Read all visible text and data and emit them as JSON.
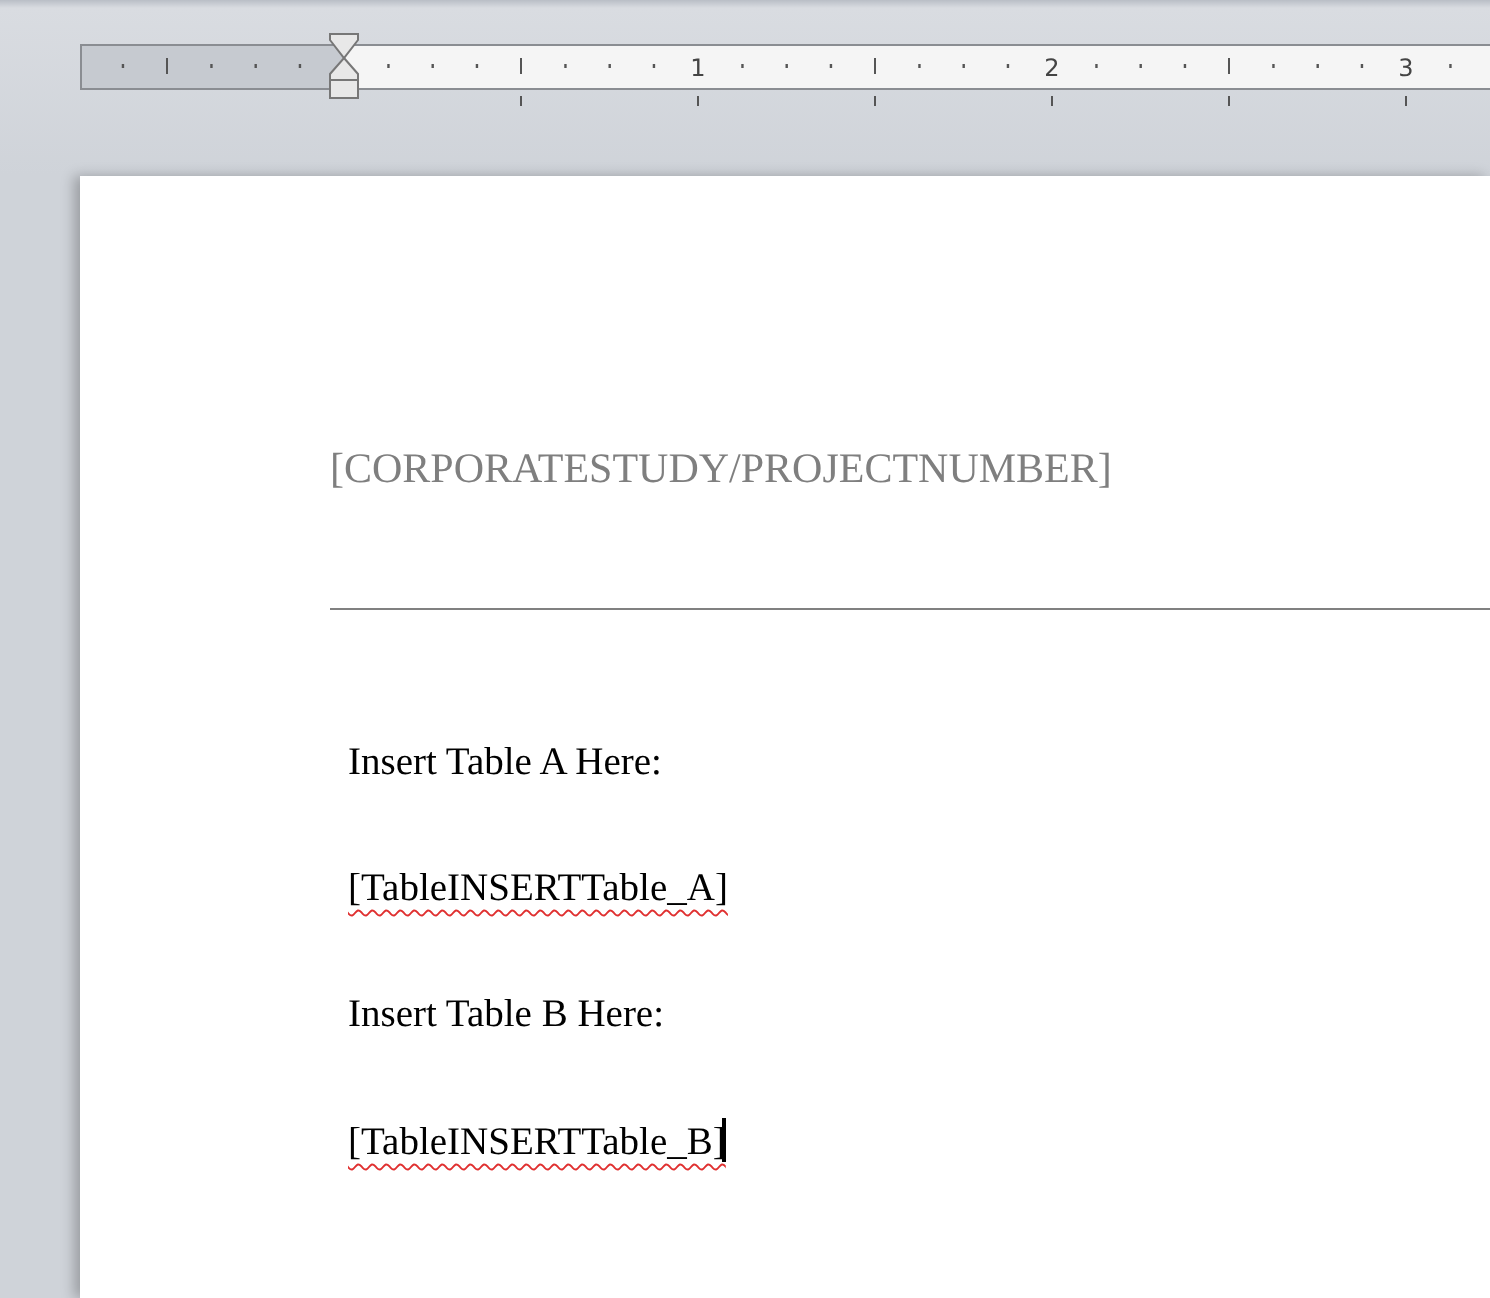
{
  "ruler": {
    "labels": [
      "1",
      "2",
      "3"
    ]
  },
  "header": {
    "text": "[CORPORATESTUDY/PROJECTNUMBER]"
  },
  "paragraphs": [
    {
      "text": "Insert Table A Here:",
      "misspelled": false,
      "caret": false
    },
    {
      "text": "[TableINSERTTable_A]",
      "misspelled": true,
      "caret": false
    },
    {
      "text": "Insert Table B Here:",
      "misspelled": false,
      "caret": false
    },
    {
      "text": "[TableINSERTTable_B]",
      "misspelled": true,
      "caret": true
    }
  ]
}
